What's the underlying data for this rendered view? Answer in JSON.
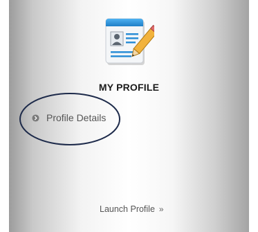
{
  "card": {
    "title": "MY PROFILE",
    "icon": "profile-card-pencil-icon",
    "menu_items": [
      {
        "label": "Profile Details",
        "icon": "circle-chevron-right-icon"
      }
    ],
    "launch_label": "Launch Profile",
    "launch_icon_glyph": "»"
  },
  "colors": {
    "annotation_ellipse": "#1d2a4a",
    "icon_header": "#2b8ed6",
    "pencil": "#f2b33d"
  }
}
